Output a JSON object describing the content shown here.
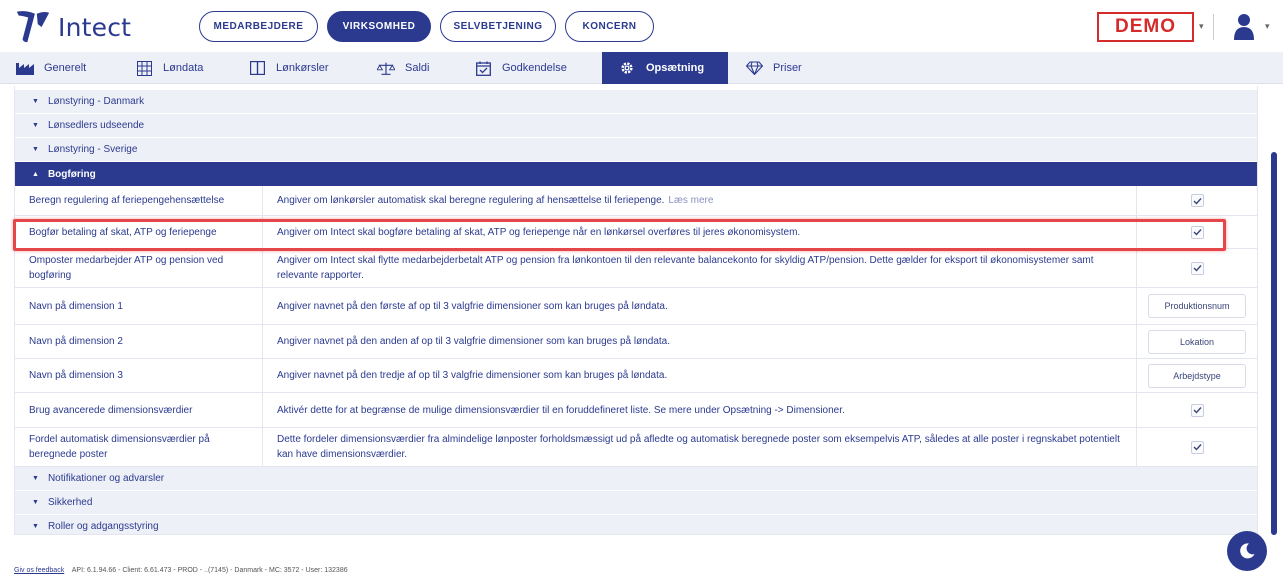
{
  "app": {
    "name": "Intect"
  },
  "topnav": [
    {
      "label": "MEDARBEJDERE",
      "active": false
    },
    {
      "label": "VIRKSOMHED",
      "active": true
    },
    {
      "label": "SELVBETJENING",
      "active": false
    },
    {
      "label": "KONCERN",
      "active": false
    }
  ],
  "demo_label": "DEMO",
  "subnav": [
    {
      "label": "Generelt",
      "icon": "factory-icon",
      "active": false
    },
    {
      "label": "Løndata",
      "icon": "grid-icon",
      "active": false
    },
    {
      "label": "Lønkørsler",
      "icon": "columns-icon",
      "active": false
    },
    {
      "label": "Saldi",
      "icon": "scale-icon",
      "active": false
    },
    {
      "label": "Godkendelse",
      "icon": "calendar-check-icon",
      "active": false
    },
    {
      "label": "Opsætning",
      "icon": "gear-icon",
      "active": true
    },
    {
      "label": "Priser",
      "icon": "diamond-icon",
      "active": false
    }
  ],
  "sections_top": [
    {
      "label": "Lønstyring - Danmark"
    },
    {
      "label": "Lønsedlers udseende"
    },
    {
      "label": "Lønstyring - Sverige"
    }
  ],
  "open_section": {
    "label": "Bogføring"
  },
  "rows": [
    {
      "name": "Beregn regulering af feriepengehensættelse",
      "desc": "Angiver om lønkørsler automatisk skal beregne regulering af hensættelse til feriepenge.",
      "readmore": "Læs mere",
      "control": "check",
      "checked": true
    },
    {
      "name": "Bogfør betaling af skat, ATP og feriepenge",
      "desc": "Angiver om Intect skal bogføre betaling af skat, ATP og feriepenge når en lønkørsel overføres til jeres økonomisystem.",
      "control": "check",
      "checked": true
    },
    {
      "name": "Omposter medarbejder ATP og pension ved bogføring",
      "desc": "Angiver om Intect skal flytte medarbejderbetalt ATP og pension fra lønkontoen til den relevante balancekonto for skyldig ATP/pension. Dette gælder for eksport til økonomisystemer samt relevante rapporter.",
      "control": "check",
      "checked": true
    },
    {
      "name": "Navn på dimension 1",
      "desc": "Angiver navnet på den første af op til 3 valgfrie dimensioner som kan bruges på løndata.",
      "control": "input",
      "value": "Produktionsnum"
    },
    {
      "name": "Navn på dimension 2",
      "desc": "Angiver navnet på den anden af op til 3 valgfrie dimensioner som kan bruges på løndata.",
      "control": "input",
      "value": "Lokation"
    },
    {
      "name": "Navn på dimension 3",
      "desc": "Angiver navnet på den tredje af op til 3 valgfrie dimensioner som kan bruges på løndata.",
      "control": "input",
      "value": "Arbejdstype"
    },
    {
      "name": "Brug avancerede dimensionsværdier",
      "desc": "Aktivér dette for at begrænse de mulige dimensionsværdier til en foruddefineret liste. Se mere under Opsætning -> Dimensioner.",
      "control": "check",
      "checked": true
    },
    {
      "name": "Fordel automatisk dimensionsværdier på beregnede poster",
      "desc": "Dette fordeler dimensionsværdier fra almindelige lønposter forholdsmæssigt ud på afledte og automatisk beregnede poster som eksempelvis ATP, således at alle poster i regnskabet potentielt kan have dimensionsværdier.",
      "control": "check",
      "checked": true
    }
  ],
  "sections_bottom": [
    {
      "label": "Notifikationer og advarsler"
    },
    {
      "label": "Sikkerhed"
    },
    {
      "label": "Roller og adgangsstyring"
    }
  ],
  "footer": {
    "feedback": "Giv os feedback",
    "info": "API: 6.1.94.66 - Client: 6.61.473 - PROD - ..(7145) - Danmark - MC: 3572 - User: 132386"
  },
  "colors": {
    "primary": "#2b3a8f",
    "demo": "#d62b2b",
    "highlight": "#e5464a",
    "row_bg": "#eef0f7"
  }
}
